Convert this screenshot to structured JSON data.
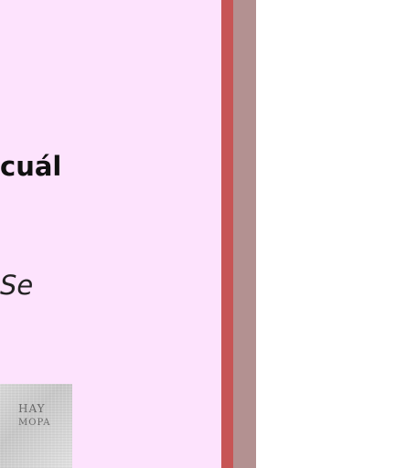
{
  "content": {
    "heading_fragment": "cuál",
    "italic_fragment": "Se",
    "thumbnail": {
      "line1": "HAY",
      "line2": "MOPA"
    }
  },
  "colors": {
    "panel_background": "#fde3fd",
    "border_red": "#c75555",
    "side_bar": "#b39191",
    "page_background": "#ffffff"
  }
}
